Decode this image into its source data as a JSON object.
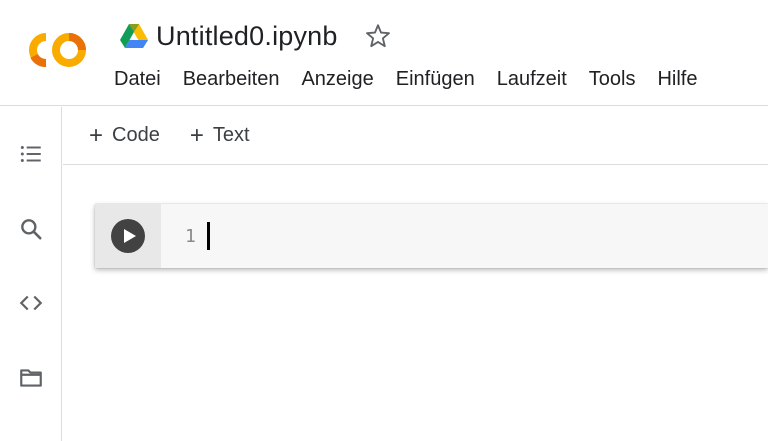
{
  "app": {
    "logo_icon": "colab-logo-icon",
    "doc_title": "Untitled0.ipynb",
    "drive_icon": "google-drive-icon",
    "star_icon": "star-outline-icon"
  },
  "menu": [
    "Datei",
    "Bearbeiten",
    "Anzeige",
    "Einfügen",
    "Laufzeit",
    "Tools",
    "Hilfe"
  ],
  "rail": [
    {
      "name": "table-of-contents-icon"
    },
    {
      "name": "search-icon"
    },
    {
      "name": "code-snippets-icon"
    },
    {
      "name": "folder-icon"
    }
  ],
  "toolbar": {
    "add_code_label": "Code",
    "add_text_label": "Text",
    "plus_glyph": "+"
  },
  "cell": {
    "run_icon": "play-icon",
    "line_number": "1",
    "content": ""
  },
  "colors": {
    "logo_orange": "#F9AB00",
    "logo_dark_orange": "#E8710A",
    "run_button": "#424242",
    "border": "#dadce0"
  }
}
